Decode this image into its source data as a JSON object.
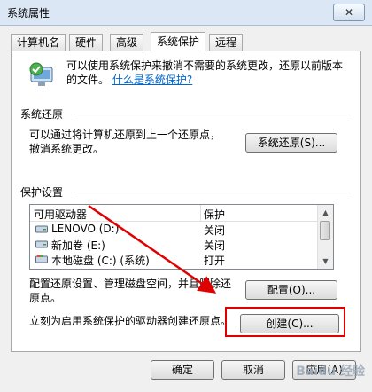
{
  "window": {
    "title": "系统属性",
    "close_glyph": "✕"
  },
  "tabs": [
    {
      "label": "计算机名"
    },
    {
      "label": "硬件"
    },
    {
      "label": "高级"
    },
    {
      "label": "系统保护"
    },
    {
      "label": "远程"
    }
  ],
  "intro": {
    "text": "可以使用系统保护来撤消不需要的系统更改，还原以前版本的文件。",
    "link": "什么是系统保护?"
  },
  "restore": {
    "title": "系统还原",
    "desc_line1": "可以通过将计算机还原到上一个还原点，",
    "desc_line2": "撤消系统更改。",
    "button": "系统还原(S)..."
  },
  "protection": {
    "title": "保护设置",
    "col_drive": "可用驱动器",
    "col_protect": "保护",
    "drives": [
      {
        "name": "LENOVO (D:)",
        "status": "关闭"
      },
      {
        "name": "新加卷 (E:)",
        "status": "关闭"
      },
      {
        "name": "本地磁盘 (C:) (系统)",
        "status": "打开"
      }
    ]
  },
  "configure": {
    "desc_line1": "配置还原设置、管理磁盘空间，并且删除还",
    "desc_line2": "原点。",
    "button": "配置(O)..."
  },
  "create": {
    "desc": "立刻为启用系统保护的驱动器创建还原点。",
    "button": "创建(C)..."
  },
  "footer": {
    "ok": "确定",
    "cancel": "取消",
    "apply": "应用(A)"
  },
  "watermark": "Baidu 经验",
  "colors": {
    "annotation_red": "#e00000",
    "link_blue": "#0066cc"
  }
}
